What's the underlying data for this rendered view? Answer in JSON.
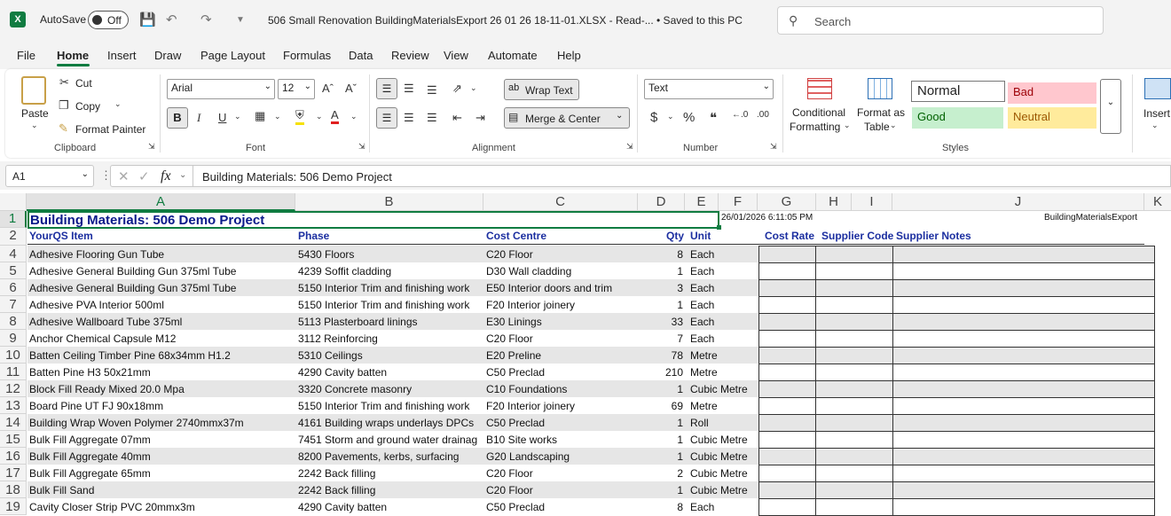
{
  "titlebar": {
    "autosave_label": "AutoSave",
    "autosave_state": "Off",
    "doc_title": "506 Small Renovation BuildingMaterialsExport 26 01 26 18-11-01.XLSX  -  Read-...   • Saved to this PC",
    "search_placeholder": "Search"
  },
  "menu": [
    "File",
    "Home",
    "Insert",
    "Draw",
    "Page Layout",
    "Formulas",
    "Data",
    "Review",
    "View",
    "Automate",
    "Help"
  ],
  "ribbon": {
    "clipboard": {
      "paste": "Paste",
      "cut": "Cut",
      "copy": "Copy",
      "format_painter": "Format Painter",
      "group": "Clipboard"
    },
    "font": {
      "name": "Arial",
      "size": "12",
      "group": "Font"
    },
    "alignment": {
      "wrap": "Wrap Text",
      "merge": "Merge & Center",
      "group": "Alignment"
    },
    "number": {
      "format": "Text",
      "group": "Number"
    },
    "styles": {
      "conditional": "Conditional",
      "conditional2": "Formatting",
      "format_as": "Format as",
      "format_as2": "Table",
      "normal": "Normal",
      "bad": "Bad",
      "good": "Good",
      "neutral": "Neutral",
      "group": "Styles"
    },
    "insert": "Insert"
  },
  "formula_bar": {
    "name_box": "A1",
    "fx": "fx",
    "content": "Building Materials: 506 Demo Project"
  },
  "columns": [
    "A",
    "B",
    "C",
    "D",
    "E",
    "F",
    "G",
    "H",
    "I",
    "J",
    "K"
  ],
  "sheet": {
    "title": "Building Materials: 506 Demo Project",
    "timestamp": "26/01/2026 6:11:05 PM",
    "export_label": "BuildingMaterialsExport",
    "headers": {
      "item": "YourQS Item",
      "phase": "Phase",
      "cost_centre": "Cost Centre",
      "qty": "Qty",
      "unit": "Unit",
      "cost_rate": "Cost Rate",
      "supplier_code": "Supplier Code",
      "supplier_notes": "Supplier Notes"
    },
    "rows": [
      {
        "n": "4",
        "item": "Adhesive Flooring Gun Tube",
        "phase": "5430 Floors",
        "cc": "C20 Floor",
        "qty": "8",
        "unit": "Each"
      },
      {
        "n": "5",
        "item": "Adhesive General Building Gun 375ml Tube",
        "phase": "4239 Soffit cladding",
        "cc": "D30 Wall cladding",
        "qty": "1",
        "unit": "Each"
      },
      {
        "n": "6",
        "item": "Adhesive General Building Gun 375ml Tube",
        "phase": "5150 Interior Trim and finishing work",
        "cc": "E50 Interior doors and trim",
        "qty": "3",
        "unit": "Each"
      },
      {
        "n": "7",
        "item": "Adhesive PVA Interior 500ml",
        "phase": "5150 Interior Trim and finishing work",
        "cc": "F20 Interior joinery",
        "qty": "1",
        "unit": "Each"
      },
      {
        "n": "8",
        "item": "Adhesive Wallboard Tube 375ml",
        "phase": "5113 Plasterboard linings",
        "cc": "E30 Linings",
        "qty": "33",
        "unit": "Each"
      },
      {
        "n": "9",
        "item": "Anchor Chemical Capsule M12",
        "phase": "3112 Reinforcing",
        "cc": "C20 Floor",
        "qty": "7",
        "unit": "Each"
      },
      {
        "n": "10",
        "item": "Batten Ceiling Timber Pine 68x34mm H1.2",
        "phase": "5310 Ceilings",
        "cc": "E20 Preline",
        "qty": "78",
        "unit": "Metre"
      },
      {
        "n": "11",
        "item": "Batten Pine H3 50x21mm",
        "phase": "4290 Cavity batten",
        "cc": "C50 Preclad",
        "qty": "210",
        "unit": "Metre"
      },
      {
        "n": "12",
        "item": "Block Fill Ready Mixed 20.0 Mpa",
        "phase": "3320 Concrete masonry",
        "cc": "C10 Foundations",
        "qty": "1",
        "unit": "Cubic Metre"
      },
      {
        "n": "13",
        "item": "Board Pine UT FJ 90x18mm",
        "phase": "5150 Interior Trim and finishing work",
        "cc": "F20 Interior joinery",
        "qty": "69",
        "unit": "Metre"
      },
      {
        "n": "14",
        "item": "Building Wrap Woven Polymer 2740mmx37m",
        "phase": "4161 Building wraps underlays DPCs",
        "cc": "C50 Preclad",
        "qty": "1",
        "unit": "Roll"
      },
      {
        "n": "15",
        "item": "Bulk Fill Aggregate 07mm",
        "phase": "7451 Storm and ground water drainag",
        "cc": "B10 Site works",
        "qty": "1",
        "unit": "Cubic Metre"
      },
      {
        "n": "16",
        "item": "Bulk Fill Aggregate 40mm",
        "phase": "8200 Pavements, kerbs, surfacing",
        "cc": "G20 Landscaping",
        "qty": "1",
        "unit": "Cubic Metre"
      },
      {
        "n": "17",
        "item": "Bulk Fill Aggregate 65mm",
        "phase": "2242 Back filling",
        "cc": "C20 Floor",
        "qty": "2",
        "unit": "Cubic Metre"
      },
      {
        "n": "18",
        "item": "Bulk Fill Sand",
        "phase": "2242 Back filling",
        "cc": "C20 Floor",
        "qty": "1",
        "unit": "Cubic Metre"
      },
      {
        "n": "19",
        "item": "Cavity Closer Strip PVC 20mmx3m",
        "phase": "4290 Cavity batten",
        "cc": "C50 Preclad",
        "qty": "8",
        "unit": "Each"
      }
    ],
    "row_numbers_top": [
      "1",
      "2"
    ]
  }
}
